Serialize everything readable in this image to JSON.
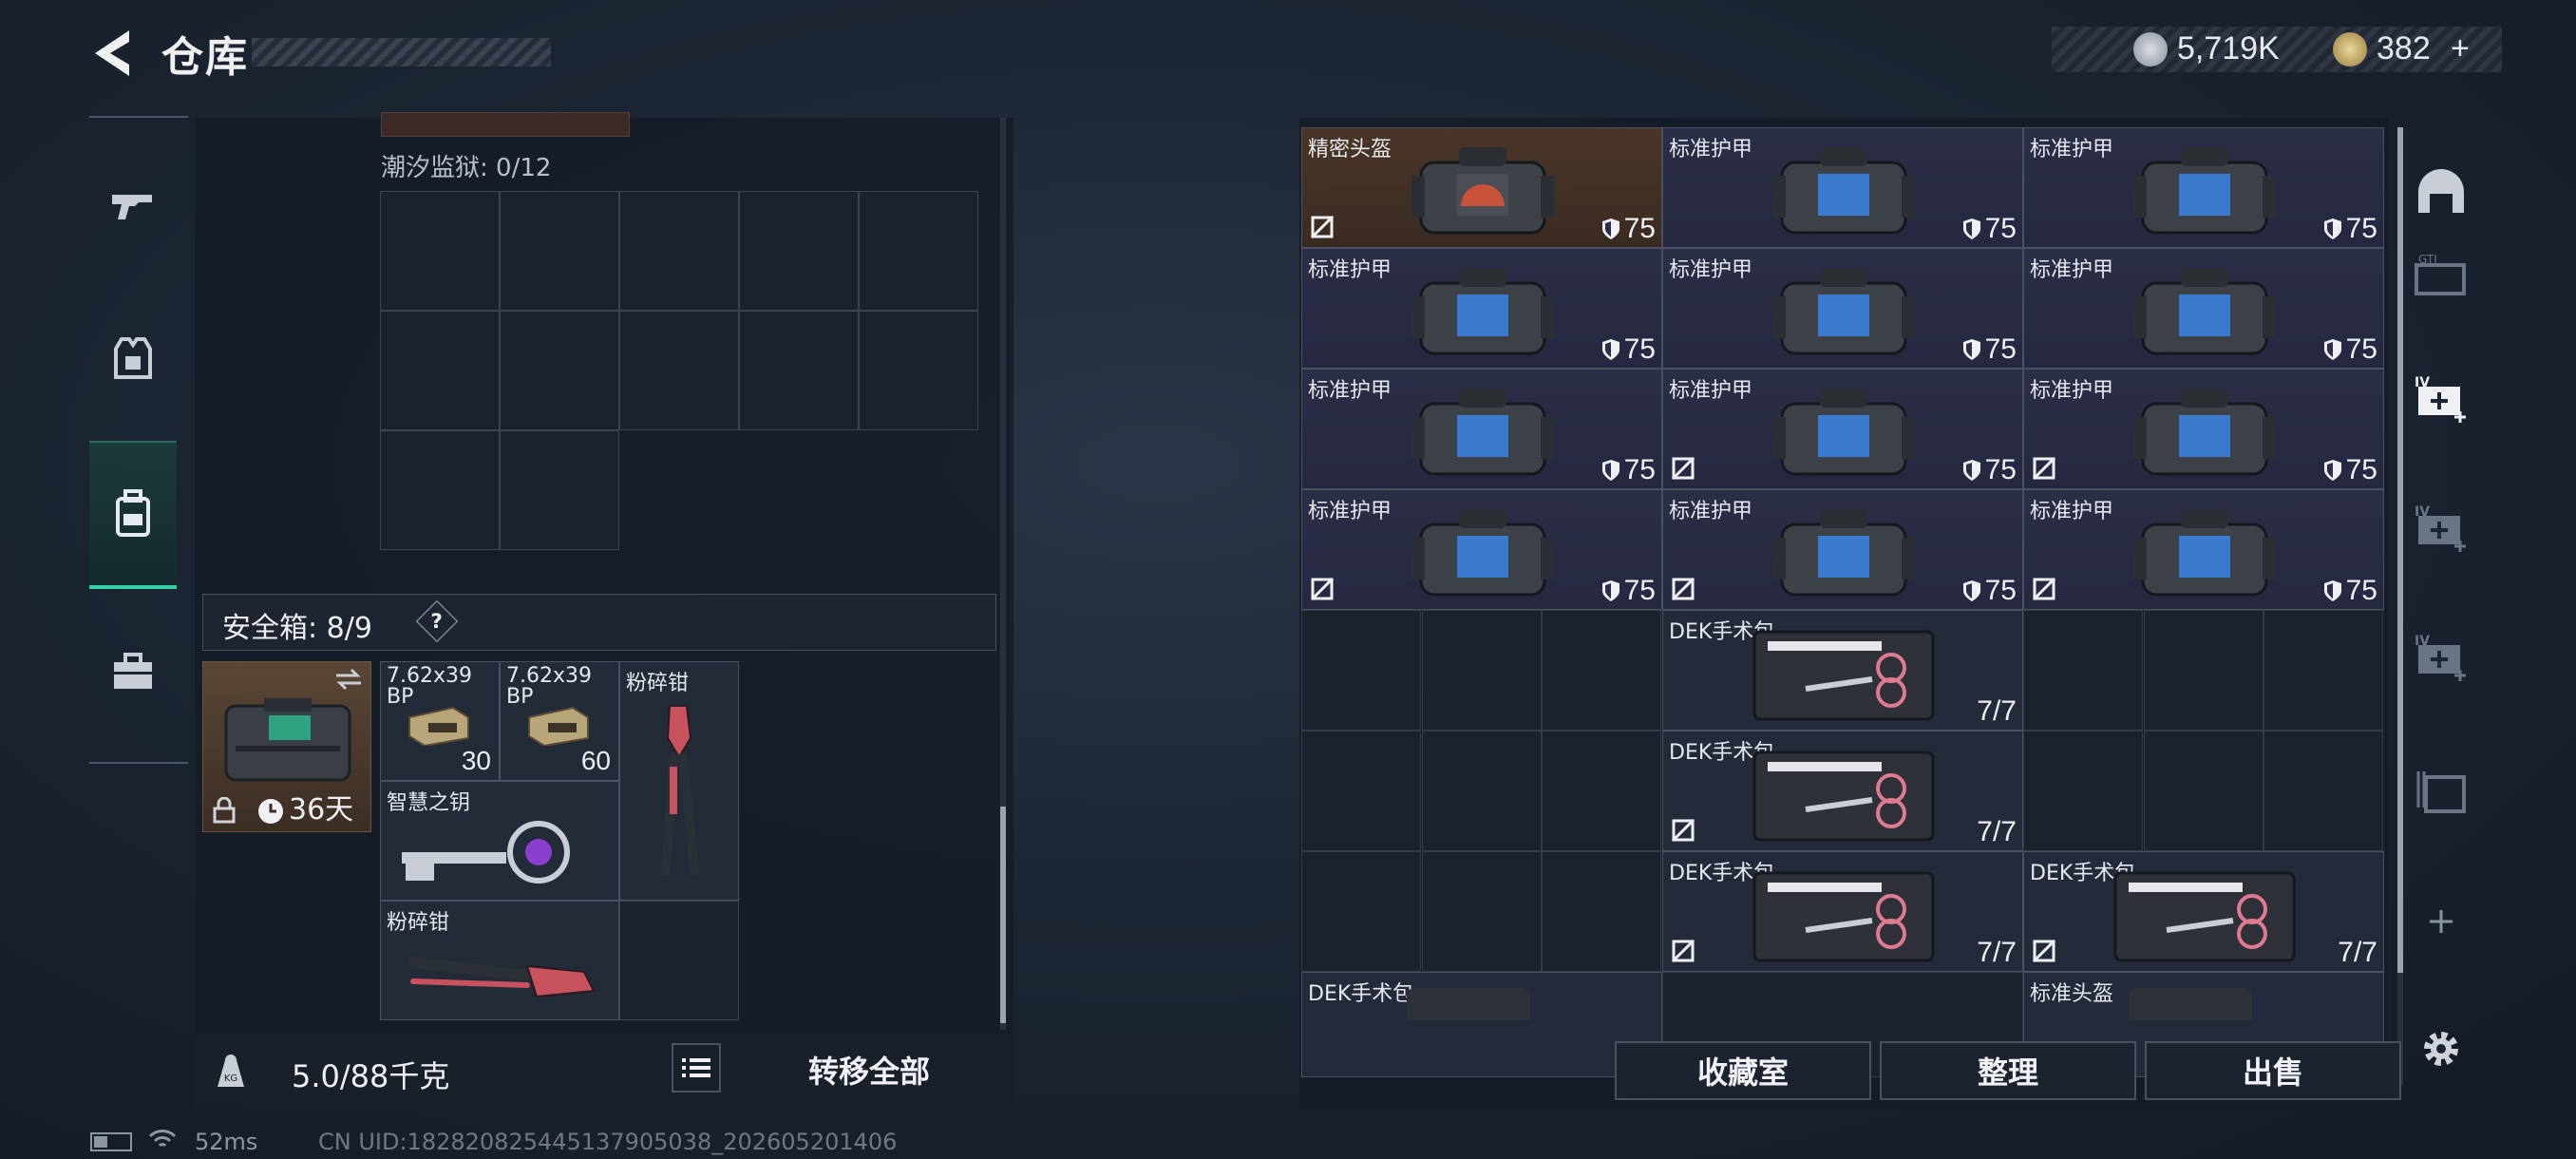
{
  "header": {
    "title": "仓库"
  },
  "currency": {
    "silver_value": "5,719K",
    "gold_value": "382",
    "gold_plus": "+"
  },
  "left_nav": {
    "items": [
      "weapon-icon",
      "armor-icon",
      "backpack-icon",
      "toolbox-icon"
    ],
    "active_index": 2
  },
  "container": {
    "name_label": "潮汐监狱: 0/12"
  },
  "safe_box": {
    "label": "安全箱: 8/9",
    "help": "?",
    "timer": "36天"
  },
  "safe_items": [
    {
      "name": "7.62x39 BP",
      "count": "30"
    },
    {
      "name": "7.62x39 BP",
      "count": "60"
    },
    {
      "name": "粉碎钳",
      "count": ""
    },
    {
      "name": "智慧之钥",
      "count": ""
    },
    {
      "name": "粉碎钳",
      "count": ""
    }
  ],
  "weight": {
    "value": "5.0/88千克"
  },
  "transfer_all_label": "转移全部",
  "stash": {
    "rows": [
      [
        {
          "name": "精密头盔",
          "value": "75",
          "broken": true,
          "type": "helmet"
        },
        {
          "name": "标准护甲",
          "value": "75",
          "broken": false,
          "type": "armor"
        },
        {
          "name": "标准护甲",
          "value": "75",
          "broken": false,
          "type": "armor"
        }
      ],
      [
        {
          "name": "标准护甲",
          "value": "75",
          "broken": false,
          "type": "armor"
        },
        {
          "name": "标准护甲",
          "value": "75",
          "broken": false,
          "type": "armor"
        },
        {
          "name": "标准护甲",
          "value": "75",
          "broken": false,
          "type": "armor"
        }
      ],
      [
        {
          "name": "标准护甲",
          "value": "75",
          "broken": false,
          "type": "armor"
        },
        {
          "name": "标准护甲",
          "value": "75",
          "broken": true,
          "type": "armor"
        },
        {
          "name": "标准护甲",
          "value": "75",
          "broken": true,
          "type": "armor"
        }
      ],
      [
        {
          "name": "标准护甲",
          "value": "75",
          "broken": true,
          "type": "armor"
        },
        {
          "name": "标准护甲",
          "value": "75",
          "broken": true,
          "type": "armor"
        },
        {
          "name": "标准护甲",
          "value": "75",
          "broken": true,
          "type": "armor"
        }
      ]
    ],
    "med_items": [
      {
        "name": "DEK手术包",
        "count": "7/7",
        "broken": false
      },
      {
        "name": "DEK手术包",
        "count": "7/7",
        "broken": true
      },
      {
        "name": "DEK手术包",
        "count": "7/7",
        "broken": true
      },
      {
        "name": "DEK手术包",
        "count": "7/7",
        "broken": true
      }
    ],
    "partial_items": [
      {
        "name": "DEK手术包"
      },
      {
        "name": "标准头盔"
      }
    ]
  },
  "buttons": {
    "collection": "收藏室",
    "organize": "整理",
    "sell": "出售"
  },
  "status_bar": {
    "ping": "52ms",
    "uid": "CN UID:182820825445137905038_202605201406"
  }
}
